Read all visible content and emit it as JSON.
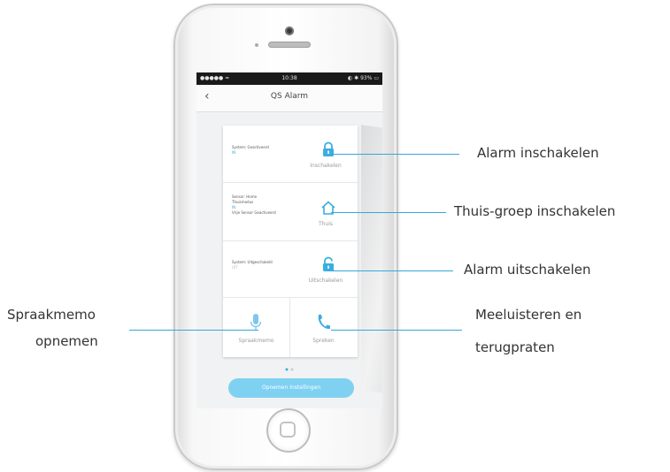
{
  "phone": {
    "status_bar": {
      "carrier": "●●●●● ≈",
      "time": "10:38",
      "battery": "◐ ✱ 93% ▭"
    },
    "nav": {
      "back_glyph": "‹",
      "title": "QS Alarm"
    },
    "card": {
      "arm": {
        "status": "System: Geactiveerd",
        "status_value": "IN",
        "button_label": "Inschakelen"
      },
      "home": {
        "status": "Sensor: Home",
        "status_line2": "Thuismodus",
        "status_value": "IN",
        "status_line3": "Vrije Sensor Geactiveerd",
        "button_label": "Thuis"
      },
      "disarm": {
        "status": "System: Uitgeschakeld",
        "status_value": "UIT",
        "button_label": "Uitschakelen"
      },
      "voice": {
        "button_label": "Spraakmemo"
      },
      "speak": {
        "button_label": "Spreken"
      }
    },
    "cta_label": "Opnemen Instellingen"
  },
  "callouts": {
    "arm": "Alarm inschakelen",
    "home": "Thuis-groep inschakelen",
    "disarm": "Alarm uitschakelen",
    "voice_line1": "Spraakmemo",
    "voice_line2": "opnemen",
    "listen_line1": "Meeluisteren en",
    "listen_line2": "terugpraten"
  },
  "colors": {
    "accent": "#37a6dc",
    "button": "#7fd1f2"
  }
}
